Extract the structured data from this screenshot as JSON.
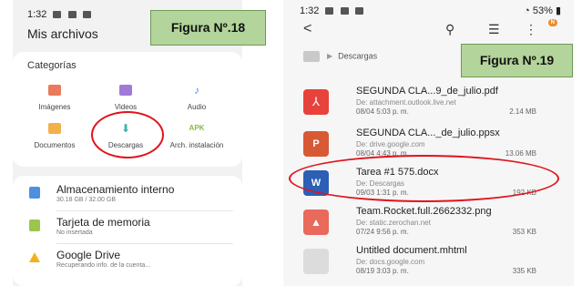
{
  "left": {
    "status_time": "1:32",
    "title": "Mis archivos",
    "categories_title": "Categorías",
    "categories": [
      {
        "label": "Imágenes",
        "icon": "image-icon",
        "color": "#e97a5c"
      },
      {
        "label": "Videos",
        "icon": "video-icon",
        "color": "#a17ad8"
      },
      {
        "label": "Audio",
        "icon": "audio-icon",
        "color": "#4f8fe0"
      },
      {
        "label": "Documentos",
        "icon": "document-icon",
        "color": "#f2b04a"
      },
      {
        "label": "Descargas",
        "icon": "download-icon",
        "color": "#3bb3a8"
      },
      {
        "label": "Arch. instalación",
        "icon_text": "APK",
        "icon": "apk-icon",
        "color": "#7cc043"
      }
    ],
    "storage": [
      {
        "name": "Almacenamiento interno",
        "sub": "30.18 GB / 32.00 GB",
        "icon": "phone-storage-icon",
        "color": "#4f8fe0"
      },
      {
        "name": "Tarjeta de memoria",
        "sub": "No insertada",
        "icon": "sd-card-icon",
        "color": "#9bc54d"
      },
      {
        "name": "Google Drive",
        "sub": "Recuperando info. de la cuenta...",
        "icon": "google-drive-icon",
        "color": "#f3b21d"
      }
    ],
    "figure_label": "Figura Nº.18"
  },
  "right": {
    "status_time": "1:32",
    "battery": "53%",
    "badge": "N",
    "breadcrumb": "Descargas",
    "figure_label": "Figura Nº.19",
    "files": [
      {
        "name": "SEGUNDA CLA...9_de_julio.pdf",
        "source": "De: attachment.outlook.live.net",
        "date": "08/04 5:03 p. m.",
        "size": "2.14 MB",
        "icon": "pdf-icon",
        "color": "#e8423c"
      },
      {
        "name": "SEGUNDA CLA..._de_julio.ppsx",
        "source": "De: drive.google.com",
        "date": "08/04 4:43 p. m.",
        "size": "13.06 MB",
        "icon": "powerpoint-icon",
        "color": "#d75a35"
      },
      {
        "name": "Tarea #1 575.docx",
        "source": "De: Descargas",
        "date": "09/03 1:31 p. m.",
        "size": "192 KB",
        "icon": "word-icon",
        "color": "#2c5fb5"
      },
      {
        "name": "Team.Rocket.full.2662332.png",
        "source": "De: static.zerochan.net",
        "date": "07/24 9:56 p. m.",
        "size": "353 KB",
        "icon": "image-file-icon",
        "color": "#e96a5a"
      },
      {
        "name": "Untitled document.mhtml",
        "source": "De: docs.google.com",
        "date": "08/19 3:03 p. m.",
        "size": "335 KB",
        "icon": "generic-file-icon",
        "color": "#cfcfcf"
      }
    ]
  }
}
